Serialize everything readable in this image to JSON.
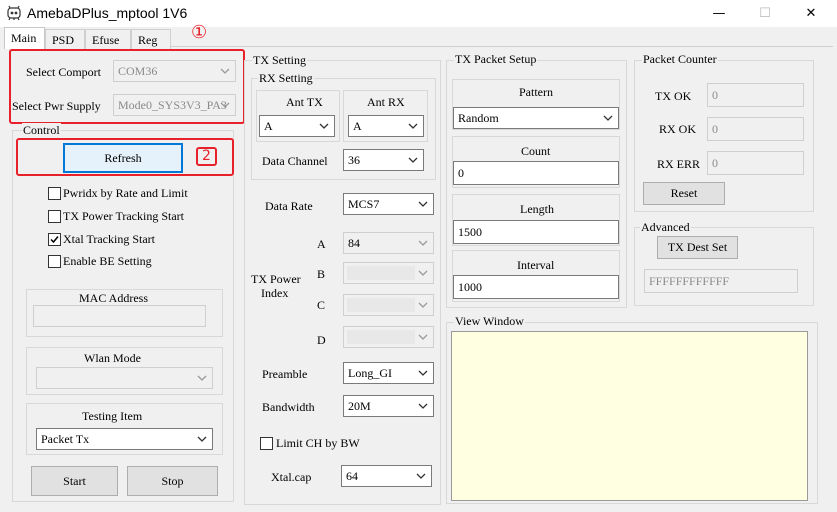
{
  "window": {
    "title": "AmebaDPlus_mptool 1V6",
    "minimize": "—",
    "maximize": "☐",
    "close": "✕"
  },
  "tabs": [
    "Main",
    "PSD",
    "Efuse",
    "Reg"
  ],
  "annotations": {
    "marker1": "①",
    "marker2": "2"
  },
  "select": {
    "comport_label": "Select  Comport",
    "comport_value": "COM36",
    "pwr_label": "Select  Pwr Supply",
    "pwr_value": "Mode0_SYS3V3_PA3"
  },
  "control": {
    "title": "Control",
    "refresh": "Refresh",
    "checkboxes": [
      {
        "label": "Pwridx by Rate and Limit",
        "checked": false
      },
      {
        "label": "TX Power Tracking Start",
        "checked": false
      },
      {
        "label": "Xtal Tracking Start",
        "checked": true
      },
      {
        "label": "Enable BE Setting",
        "checked": false
      }
    ],
    "mac_address_title": "MAC Address",
    "mac_address_value": "",
    "wlan_mode_title": "Wlan Mode",
    "wlan_mode_value": "",
    "testing_item_title": "Testing Item",
    "testing_item_value": "Packet Tx",
    "start": "Start",
    "stop": "Stop"
  },
  "tx_setting": {
    "title": "TX Setting",
    "rx_setting_title": "RX Setting",
    "ant_tx_title": "Ant TX",
    "ant_tx_value": "A",
    "ant_rx_title": "Ant RX",
    "ant_rx_value": "A",
    "data_channel_label": "Data Channel",
    "data_channel_value": "36",
    "data_rate_label": "Data Rate",
    "data_rate_value": "MCS7",
    "tx_power_index_label_1": "TX Power",
    "tx_power_index_label_2": "Index",
    "power_a_label": "A",
    "power_a_value": "84",
    "power_b_label": "B",
    "power_c_label": "C",
    "power_d_label": "D",
    "preamble_label": "Preamble",
    "preamble_value": "Long_GI",
    "bandwidth_label": "Bandwidth",
    "bandwidth_value": "20M",
    "limit_ch_label": "Limit CH by  BW",
    "xtal_cap_label": "Xtal.cap",
    "xtal_cap_value": "64"
  },
  "tx_packet": {
    "title": "TX Packet Setup",
    "pattern_title": "Pattern",
    "pattern_value": "Random",
    "count_title": "Count",
    "count_value": "0",
    "length_title": "Length",
    "length_value": "1500",
    "interval_title": "Interval",
    "interval_value": "1000"
  },
  "packet_counter": {
    "title": "Packet Counter",
    "tx_ok_label": "TX OK",
    "tx_ok_value": "0",
    "rx_ok_label": "RX OK",
    "rx_ok_value": "0",
    "rx_err_label": "RX ERR",
    "rx_err_value": "0",
    "reset": "Reset"
  },
  "advanced": {
    "title": "Advanced",
    "tx_dest_set": "TX Dest Set",
    "dest_value": "FFFFFFFFFFFF"
  },
  "view_window": {
    "title": "View Window"
  },
  "colors": {
    "annotation_red": "#e8202a",
    "focus_blue": "#0078d7",
    "view_bg": "#ffffe1"
  }
}
